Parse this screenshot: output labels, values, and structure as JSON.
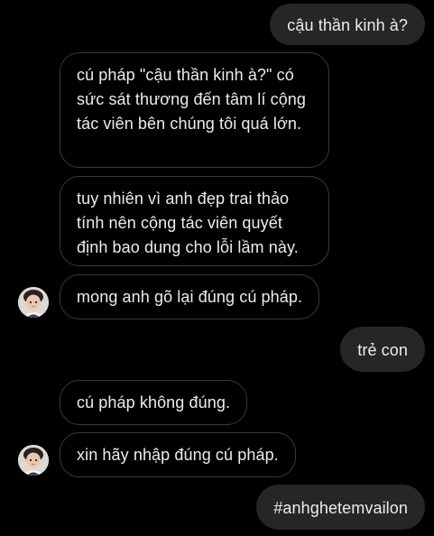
{
  "conversation": {
    "messages": [
      {
        "sender": "me",
        "text": "cậu thần kinh à?"
      },
      {
        "sender": "them",
        "text": "cú pháp \"cậu thần kinh à?\" có sức sát thương đến tâm lí cộng tác viên bên chúng tôi quá lớn."
      },
      {
        "sender": "them",
        "text": "tuy nhiên vì anh đẹp trai thảo tính nên cộng tác viên quyết định bao dung cho lỗi lầm này."
      },
      {
        "sender": "them",
        "text": "mong anh gõ lại đúng cú pháp."
      },
      {
        "sender": "me",
        "text": "trẻ con"
      },
      {
        "sender": "them",
        "text": "cú pháp không đúng."
      },
      {
        "sender": "them",
        "text": "xin hãy nhập đúng cú pháp."
      },
      {
        "sender": "me",
        "text": "#anhghetemvailon"
      }
    ],
    "avatar_icon": "user-avatar"
  },
  "colors": {
    "background": "#000000",
    "outgoing_bubble": "#262626",
    "incoming_border": "#3a3a3a",
    "text": "#ececec"
  }
}
